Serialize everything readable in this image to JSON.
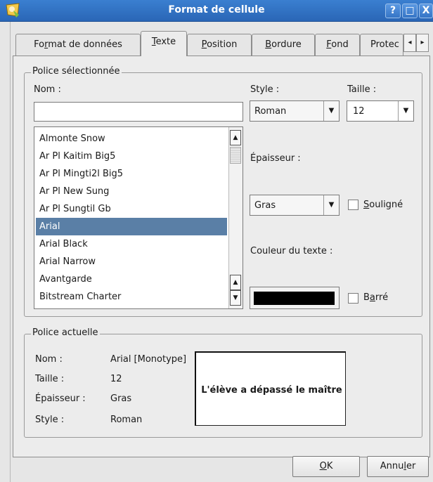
{
  "window": {
    "title": "Format de cellule",
    "controls": {
      "help": "?",
      "maximize": "□",
      "close": "X"
    }
  },
  "tabs": [
    {
      "label": "Format de données",
      "active": false
    },
    {
      "label": "Texte",
      "active": true
    },
    {
      "label": "Position",
      "active": false
    },
    {
      "label": "Bordure",
      "active": false
    },
    {
      "label": "Fond",
      "active": false
    },
    {
      "label": "Protec",
      "active": false
    }
  ],
  "tab_scroll": {
    "left": "◂",
    "right": "▸"
  },
  "selected_font": {
    "legend": "Police sélectionnée",
    "name_label": "Nom :",
    "name_value": "",
    "style_label": "Style :",
    "style_value": "Roman",
    "size_label": "Taille :",
    "size_value": "12",
    "fonts": [
      "Almonte Snow",
      "Ar Pl Kaitim Big5",
      "Ar Pl Mingti2l Big5",
      "Ar Pl New Sung",
      "Ar Pl Sungtil Gb",
      "Arial",
      "Arial Black",
      "Arial Narrow",
      "Avantgarde",
      "Bitstream Charter"
    ],
    "selected_index": 5,
    "weight_label": "Épaisseur :",
    "weight_value": "Gras",
    "underline_label": "Souligné",
    "color_label": "Couleur du texte :",
    "text_color": "#000000",
    "strike_label": "Barré"
  },
  "current_font": {
    "legend": "Police actuelle",
    "rows": [
      {
        "label": "Nom :",
        "value": "Arial [Monotype]"
      },
      {
        "label": "Taille :",
        "value": "12"
      },
      {
        "label": "Épaisseur :",
        "value": "Gras"
      },
      {
        "label": "Style :",
        "value": "Roman"
      }
    ],
    "preview_text": "L'élève a dépassé le maître"
  },
  "buttons": {
    "ok": "OK",
    "cancel": "Annuler"
  },
  "colors": {
    "titlebar": "#2f6fc2",
    "selection": "#5a7fa6",
    "background": "#ececec"
  }
}
